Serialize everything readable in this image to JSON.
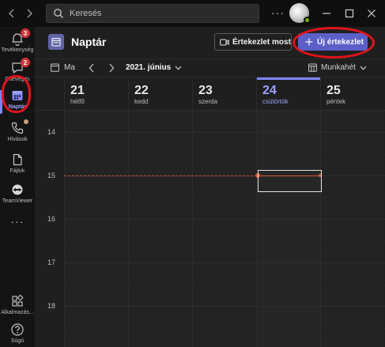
{
  "titlebar": {
    "search_placeholder": "Keresés",
    "more": "···"
  },
  "rail": {
    "items": [
      {
        "label": "Tevékenység",
        "icon": "bell-icon",
        "badge": "3"
      },
      {
        "label": "Csevegés",
        "icon": "chat-icon",
        "badge": "2"
      },
      {
        "label": "Naptár",
        "icon": "calendar-icon",
        "active": true
      },
      {
        "label": "Hívások",
        "icon": "phone-icon"
      },
      {
        "label": "Fájlok",
        "icon": "file-icon"
      },
      {
        "label": "TeamViewer",
        "icon": "teamviewer-icon"
      }
    ],
    "more": "···",
    "apps_label": "Alkalmazás...",
    "help_label": "Súgó"
  },
  "header": {
    "title": "Naptár",
    "meet_now": "Értekezlet most",
    "new_meeting": "Új értekezlet"
  },
  "toolbar": {
    "today": "Ma",
    "month": "2021. június",
    "view": "Munkahét"
  },
  "days": [
    {
      "num": "21",
      "name": "hétfő"
    },
    {
      "num": "22",
      "name": "kedd"
    },
    {
      "num": "23",
      "name": "szerda"
    },
    {
      "num": "24",
      "name": "csütörtök",
      "today": true
    },
    {
      "num": "25",
      "name": "péntek"
    }
  ],
  "hours": [
    "14",
    "15",
    "16",
    "17",
    "18"
  ],
  "colors": {
    "accent": "#6264a7",
    "accent_button": "#5b5fc7",
    "today_text": "#9ea2ff",
    "now_line": "#d45a36",
    "annotation_red": "#e1131b",
    "badge_red": "#d13438"
  }
}
